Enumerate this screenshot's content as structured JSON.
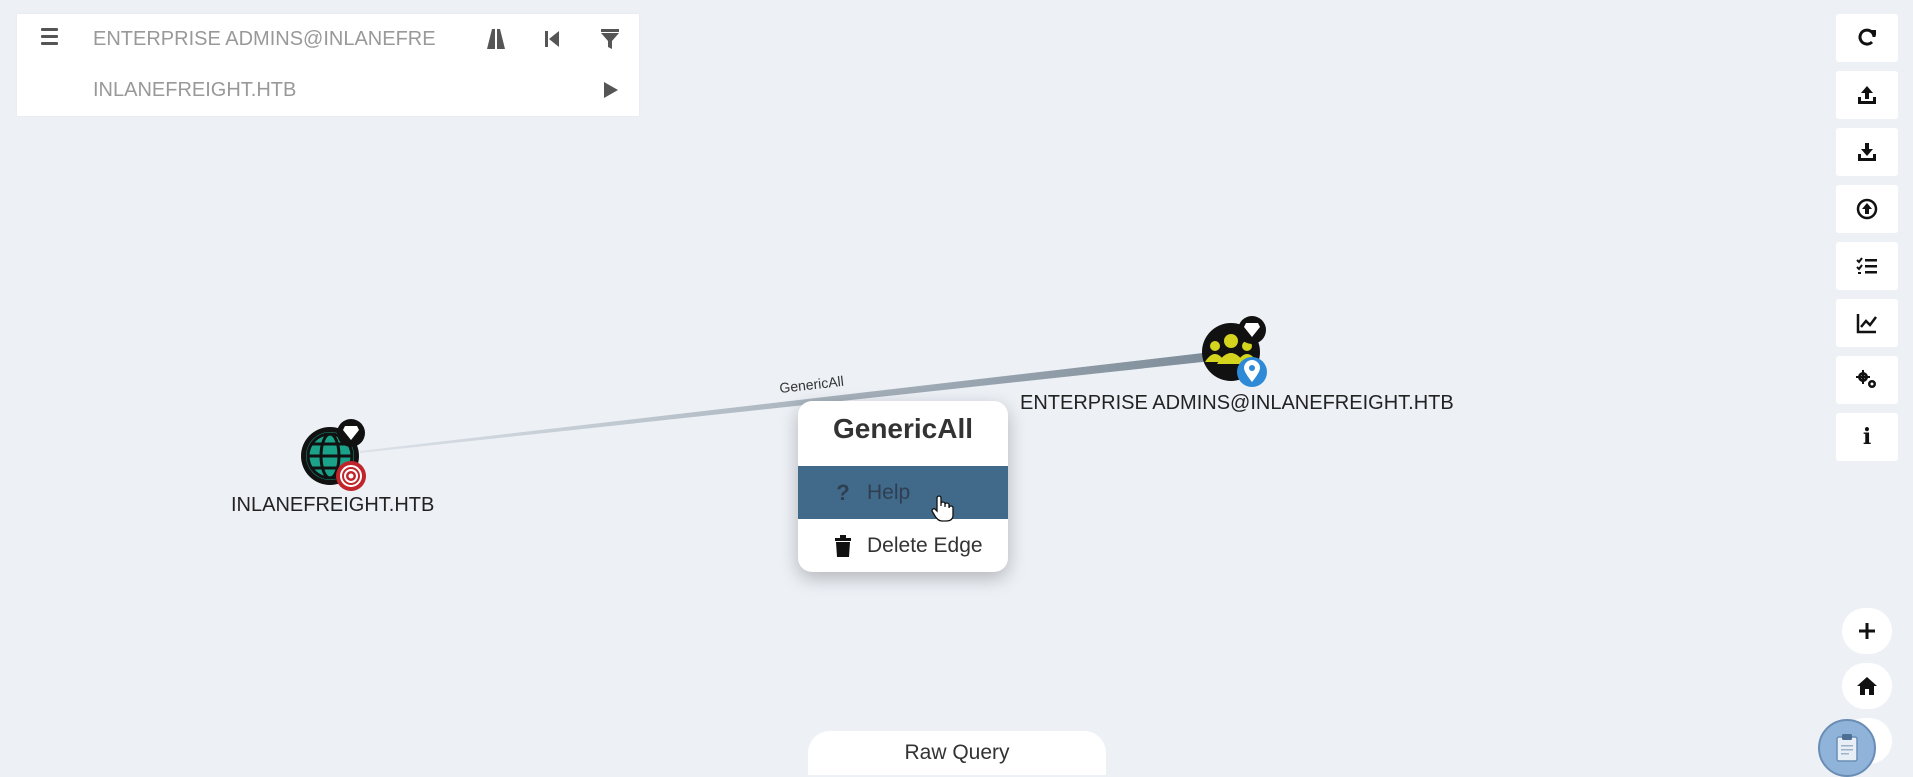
{
  "search": {
    "start_node": "ENTERPRISE ADMINS@INLANEFRE",
    "target_node": "INLANEFREIGHT.HTB"
  },
  "graph": {
    "edge_label": "GenericAll",
    "source_node": "ENTERPRISE ADMINS@INLANEFREIGHT.HTB",
    "target_node": "INLANEFREIGHT.HTB",
    "colors": {
      "edge": "#7d8c99",
      "domain_node": "#1aa389",
      "group_node": "#d4d31e",
      "owned_badge": "#c0252b",
      "highvalue_badge": "#111111",
      "start_badge": "#2e8ad6"
    }
  },
  "context_menu": {
    "title": "GenericAll",
    "help_label": "Help",
    "delete_label": "Delete Edge",
    "highlight_color": "#41698a"
  },
  "right_toolbar": {
    "buttons": [
      "refresh-icon",
      "upload-icon",
      "download-icon",
      "import-icon",
      "queries-icon",
      "database-info-icon",
      "settings-icon",
      "about-icon"
    ],
    "about_glyph": "i"
  },
  "zoom_controls": {
    "zoom_in": "+",
    "zoom_out": "-"
  },
  "raw_query": {
    "label": "Raw Query"
  }
}
